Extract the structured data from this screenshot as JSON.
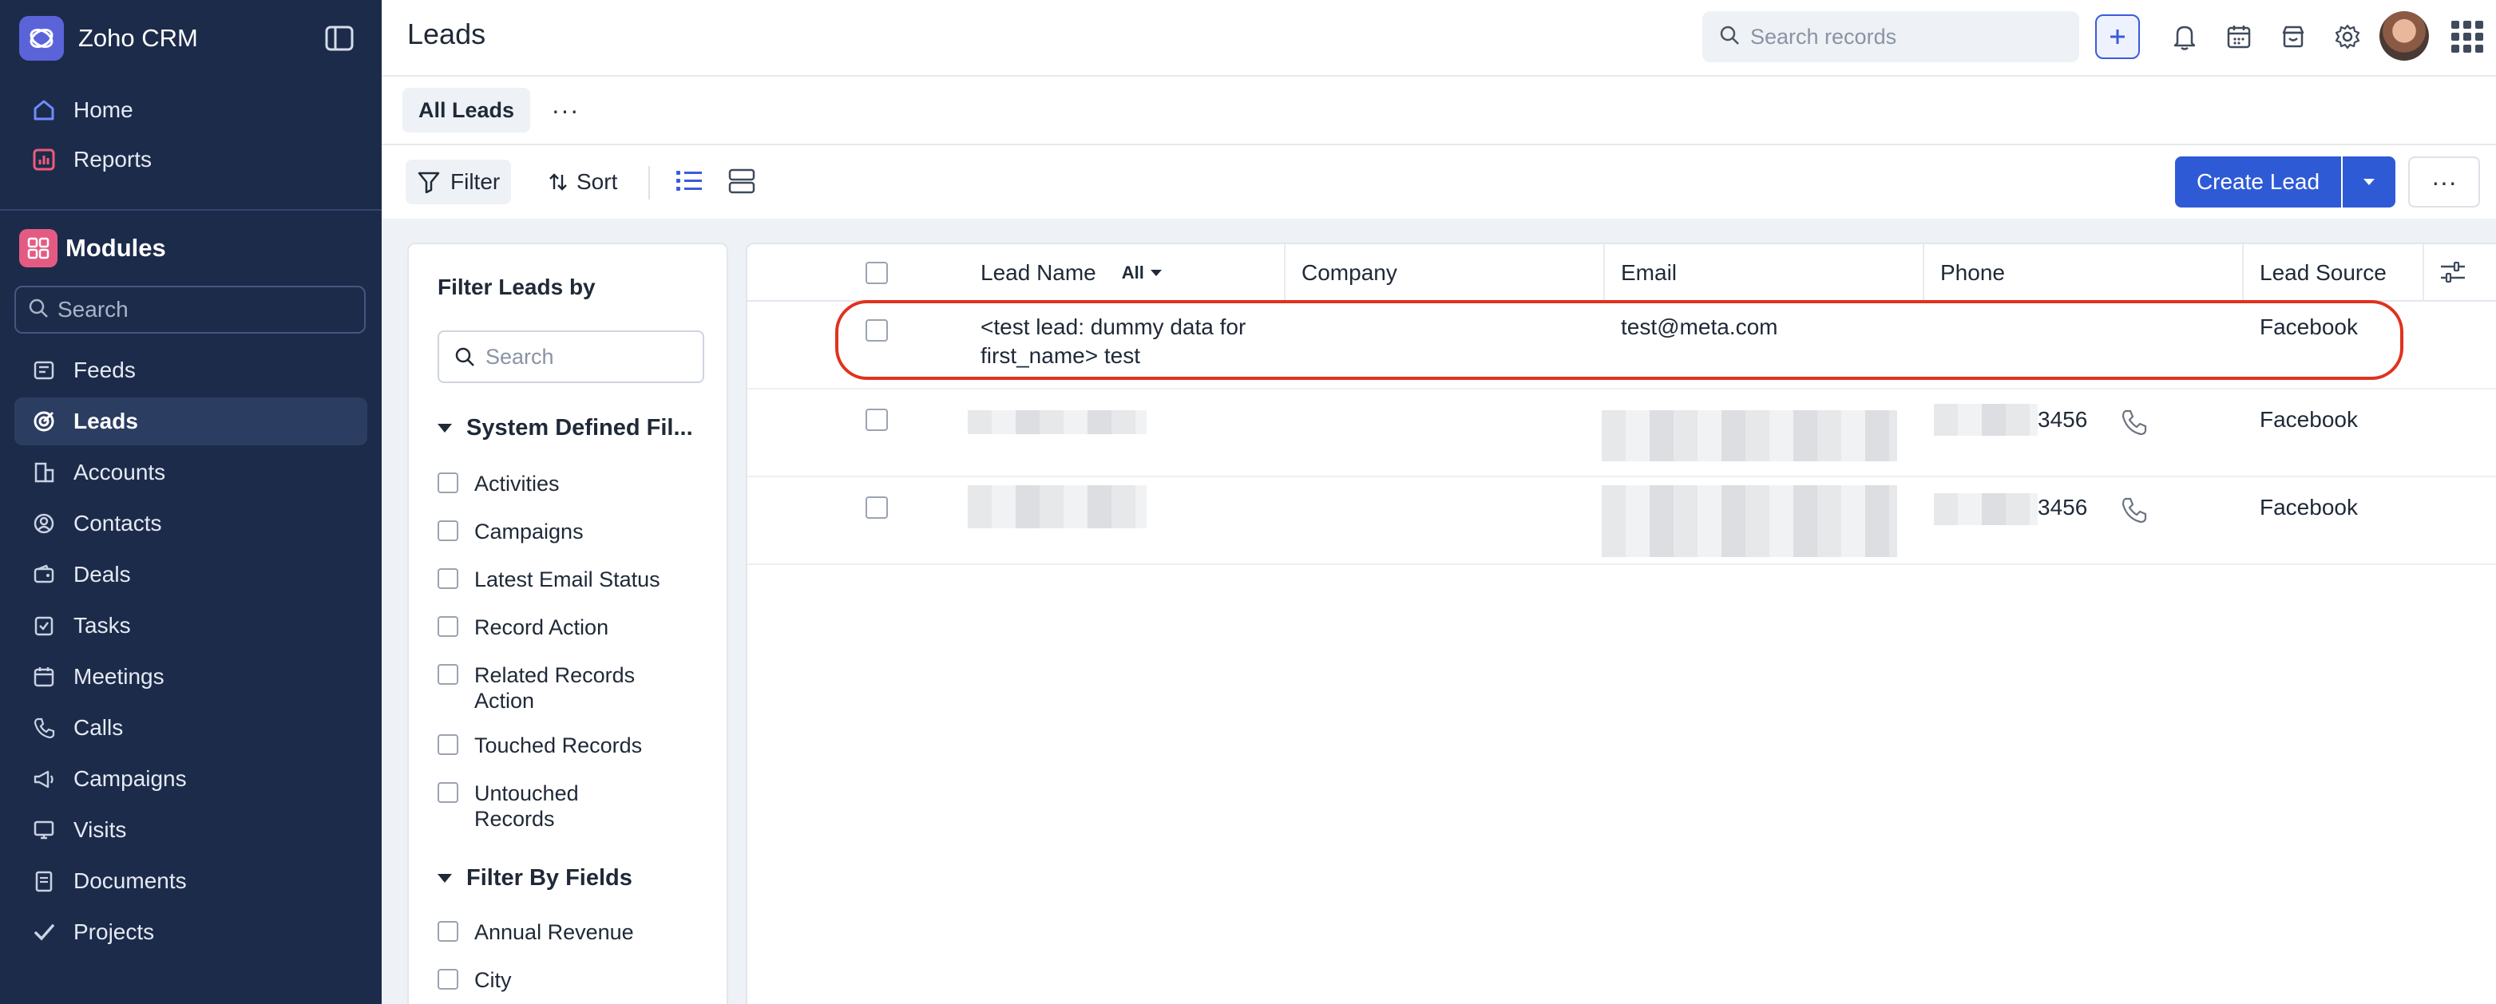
{
  "app": {
    "name": "Zoho CRM"
  },
  "sidebar": {
    "top_items": [
      {
        "label": "Home",
        "icon": "home-icon"
      },
      {
        "label": "Reports",
        "icon": "reports-icon"
      }
    ],
    "modules_label": "Modules",
    "search_placeholder": "Search",
    "modules": [
      {
        "label": "Feeds",
        "icon": "feeds-icon"
      },
      {
        "label": "Leads",
        "icon": "leads-icon",
        "active": true
      },
      {
        "label": "Accounts",
        "icon": "accounts-icon"
      },
      {
        "label": "Contacts",
        "icon": "contacts-icon"
      },
      {
        "label": "Deals",
        "icon": "deals-icon"
      },
      {
        "label": "Tasks",
        "icon": "tasks-icon"
      },
      {
        "label": "Meetings",
        "icon": "meetings-icon"
      },
      {
        "label": "Calls",
        "icon": "calls-icon"
      },
      {
        "label": "Campaigns",
        "icon": "campaigns-icon"
      },
      {
        "label": "Visits",
        "icon": "visits-icon"
      },
      {
        "label": "Documents",
        "icon": "documents-icon"
      },
      {
        "label": "Projects",
        "icon": "projects-icon"
      }
    ]
  },
  "header": {
    "title": "Leads",
    "search_placeholder": "Search records"
  },
  "views": {
    "current": "All Leads",
    "more": "···"
  },
  "toolbar": {
    "filter_label": "Filter",
    "sort_label": "Sort",
    "create_label": "Create Lead",
    "more": "···"
  },
  "filter_panel": {
    "title": "Filter Leads by",
    "search_placeholder": "Search",
    "system_section": "System Defined Fil...",
    "system_items": [
      "Activities",
      "Campaigns",
      "Latest Email Status",
      "Record Action",
      "Related Records Action",
      "Touched Records",
      "Untouched Records"
    ],
    "fields_section": "Filter By Fields",
    "field_items": [
      "Annual Revenue",
      "City"
    ]
  },
  "table": {
    "columns": [
      "Lead Name",
      "Company",
      "Email",
      "Phone",
      "Lead Source"
    ],
    "lead_name_filter": "All",
    "rows": [
      {
        "lead_name": "<test lead: dummy data for first_name> test",
        "company": "",
        "email": "test@meta.com",
        "phone": "",
        "lead_source": "Facebook"
      },
      {
        "lead_name": "",
        "company": "",
        "email": "",
        "phone": "3456",
        "lead_source": "Facebook"
      },
      {
        "lead_name": "",
        "company": "",
        "email": "",
        "phone": "3456",
        "lead_source": "Facebook"
      }
    ]
  },
  "colors": {
    "sidebar_bg": "#1c2b4a",
    "accent": "#2f5ad6",
    "highlight": "#e0321e"
  }
}
